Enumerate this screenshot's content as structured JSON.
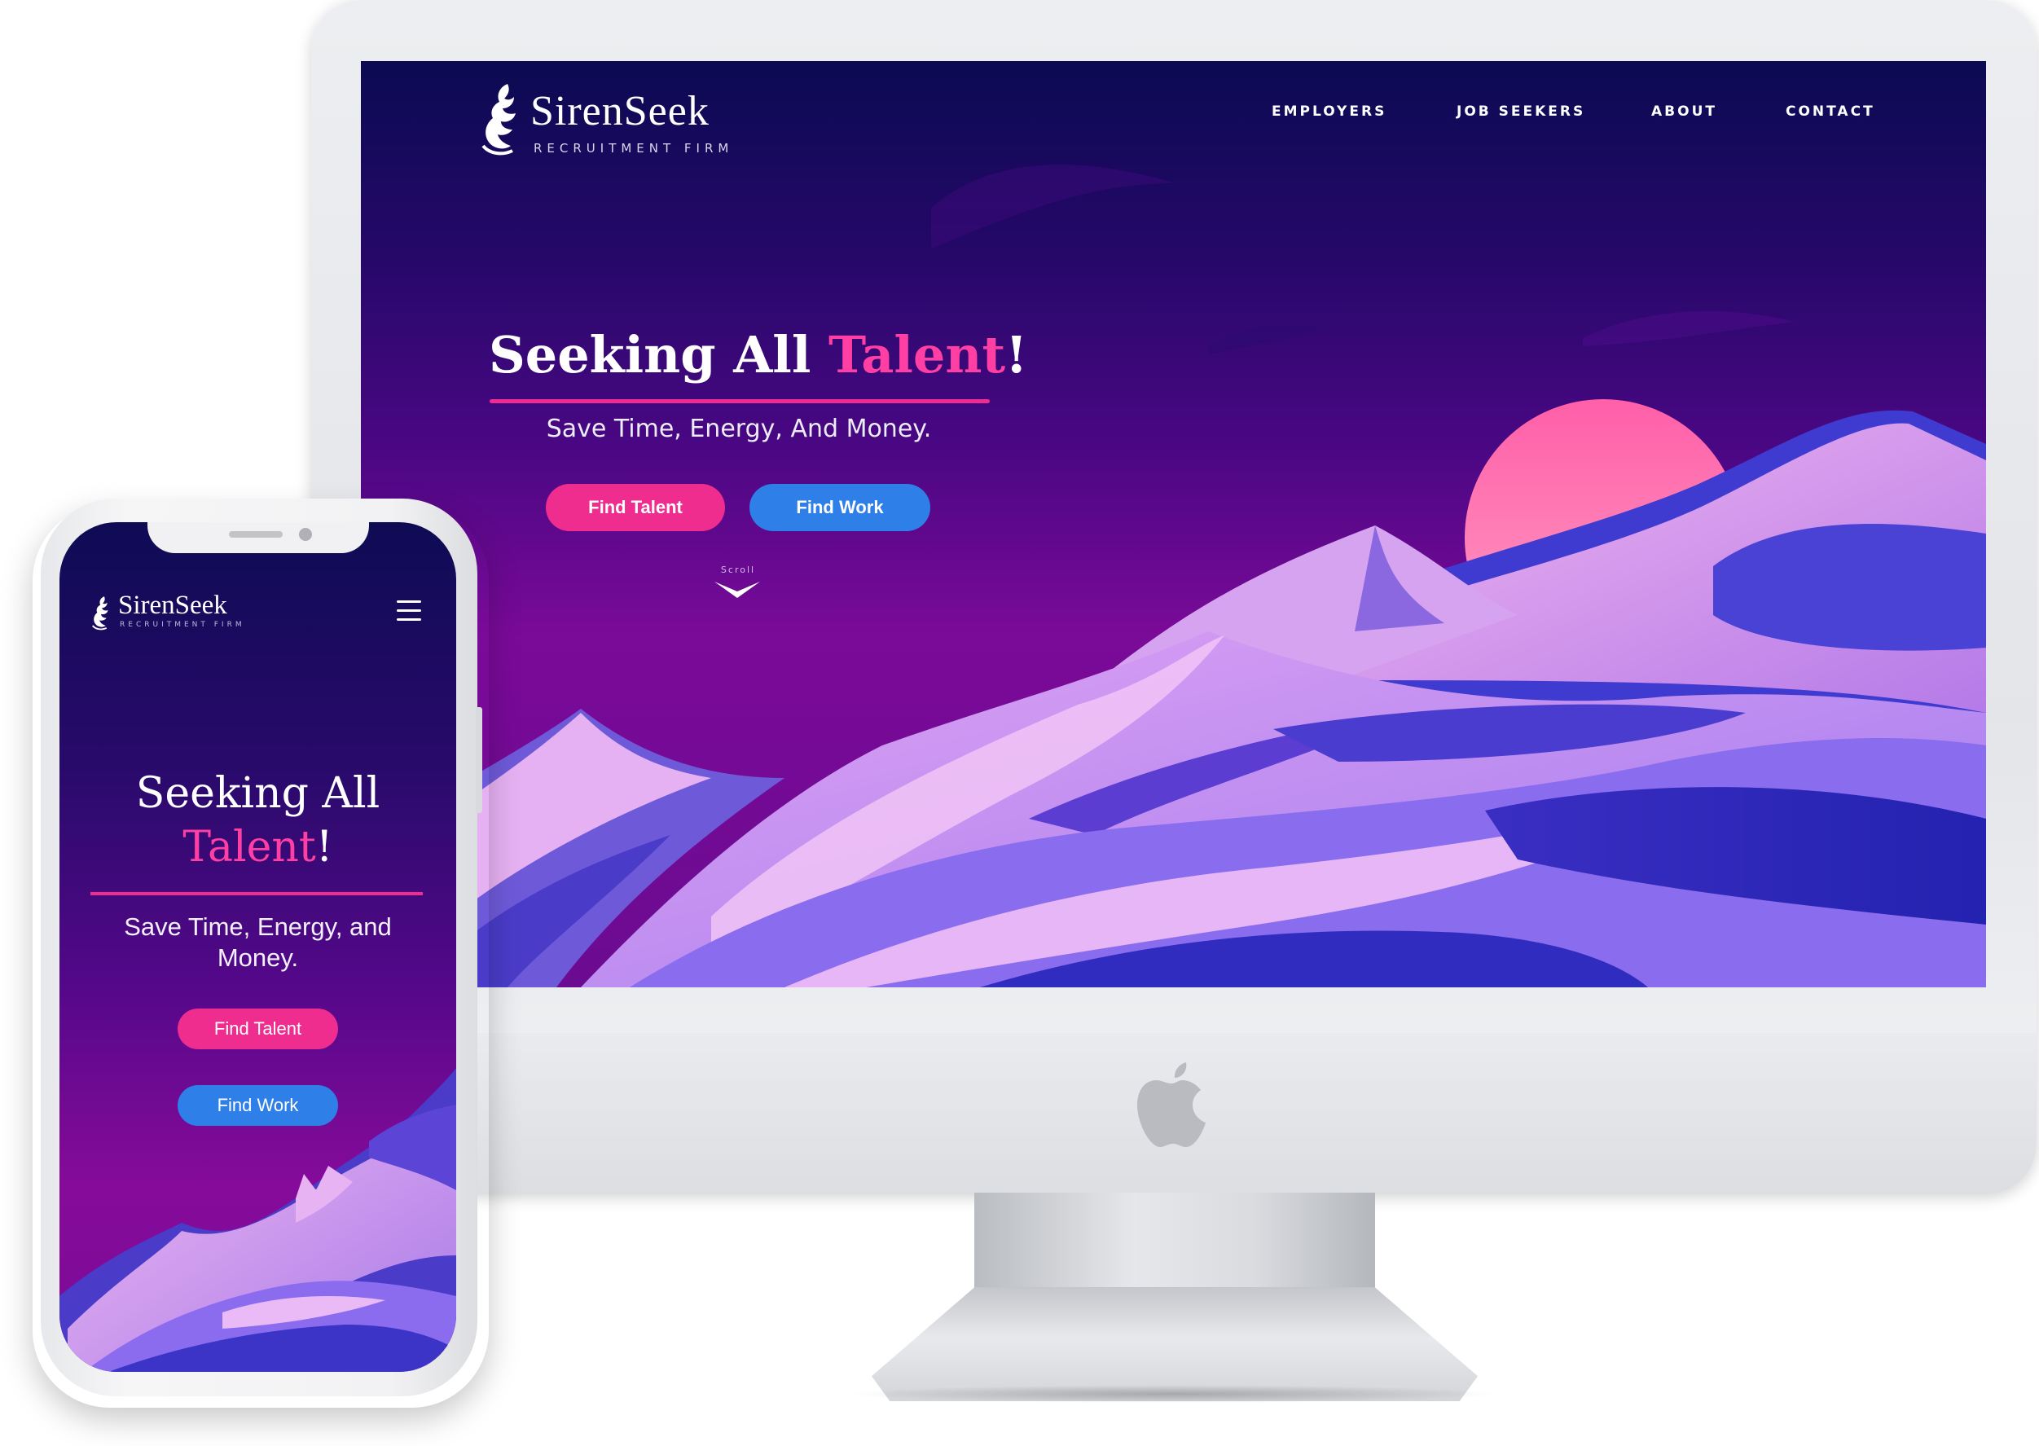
{
  "desktop": {
    "brand": {
      "name": "SirenSeek",
      "tagline": "RECRUITMENT FIRM"
    },
    "nav": [
      {
        "label": "EMPLOYERS"
      },
      {
        "label": "JOB SEEKERS"
      },
      {
        "label": "ABOUT"
      },
      {
        "label": "CONTACT"
      }
    ],
    "hero": {
      "title_main": "Seeking All ",
      "title_accent": "Talent",
      "title_end": "!",
      "subtitle": "Save Time, Energy, And Money.",
      "primary_button": "Find Talent",
      "secondary_button": "Find Work",
      "scroll_label": "Scroll"
    }
  },
  "mobile": {
    "brand": {
      "name": "SirenSeek",
      "tagline": "RECRUITMENT FIRM"
    },
    "hero": {
      "title_line1": "Seeking All",
      "title_accent": "Talent",
      "title_end": "!",
      "subtitle": "Save Time, Energy, and Money.",
      "primary_button": "Find Talent",
      "secondary_button": "Find Work"
    }
  },
  "icons": {
    "brand_mark": "siren-logo-icon",
    "menu": "hamburger-menu-icon",
    "scroll": "chevron-down-icon",
    "device_logo": "apple-logo-icon"
  },
  "colors": {
    "accent_pink": "#ee2d8f",
    "accent_blue": "#2f7fe8",
    "background_top": "#0b0a52",
    "background_bottom": "#7a0a98",
    "sun": "#ff5fa8"
  }
}
